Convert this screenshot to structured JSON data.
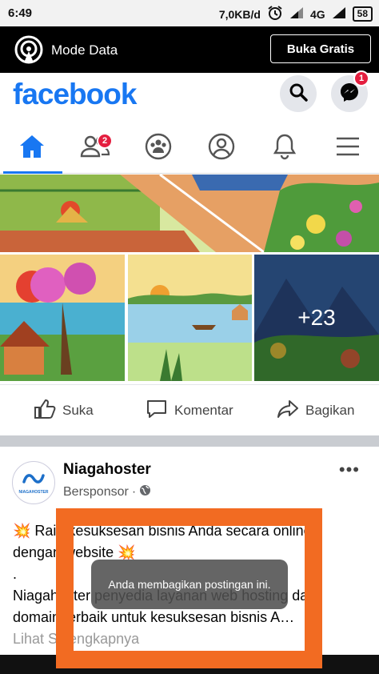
{
  "status_bar": {
    "time": "6:49",
    "speed": "7,0KB/d",
    "network": "4G",
    "battery": "58"
  },
  "data_bar": {
    "label": "Mode Data",
    "button_label": "Buka Gratis"
  },
  "header": {
    "logo": "facebook",
    "messenger_badge": "1"
  },
  "nav": {
    "friends_badge": "2"
  },
  "photos": {
    "more_count": "+23"
  },
  "actions": {
    "like": "Suka",
    "comment": "Komentar",
    "share": "Bagikan"
  },
  "post": {
    "author": "Niagahoster",
    "sponsored": "Bersponsor",
    "avatar_text": "NIAGAHOSTER",
    "more": "•••",
    "lines": [
      "💥 Raih kesuksesan bisnis Anda secara online",
      "dengan website 💥",
      ".",
      "Niagahoster penyedia layanan web hosting dan",
      "domain terbaik untuk kesuksesan bisnis A…"
    ],
    "see_more": "Lihat Selengkapnya"
  },
  "toast": {
    "message": "Anda membagikan postingan ini."
  },
  "colors": {
    "fb_blue": "#1877f2",
    "badge_red": "#e41e3f",
    "highlight_orange": "#f26b22"
  }
}
